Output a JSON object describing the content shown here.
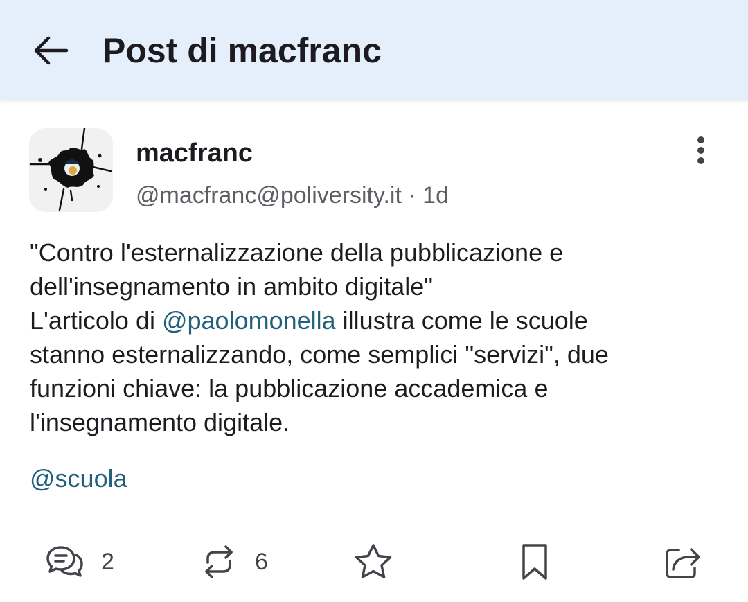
{
  "header": {
    "title": "Post di macfranc"
  },
  "post": {
    "author_name": "macfranc",
    "author_handle": "@macfranc@poliversity.it",
    "separator": "·",
    "time_ago": "1d",
    "line1": "\"Contro l'esternalizzazione della pubblicazione e",
    "line2": "dell'insegnamento in ambito digitale\"",
    "line3_prefix": "L'articolo di ",
    "mention": "@paolomonella",
    "line3_suffix": " illustra come le scuole",
    "line4": "stanno esternalizzando, come semplici \"servizi\", due",
    "line5": "funzioni chiave: la pubblicazione accademica e",
    "line6": "l'insegnamento digitale.",
    "hashtag": "@scuola"
  },
  "actions": {
    "reply_count": "2",
    "boost_count": "6"
  },
  "colors": {
    "header_bg": "#e5effc",
    "link": "#215f7a",
    "text": "#1d1b20",
    "secondary_text": "#5f5d63"
  }
}
